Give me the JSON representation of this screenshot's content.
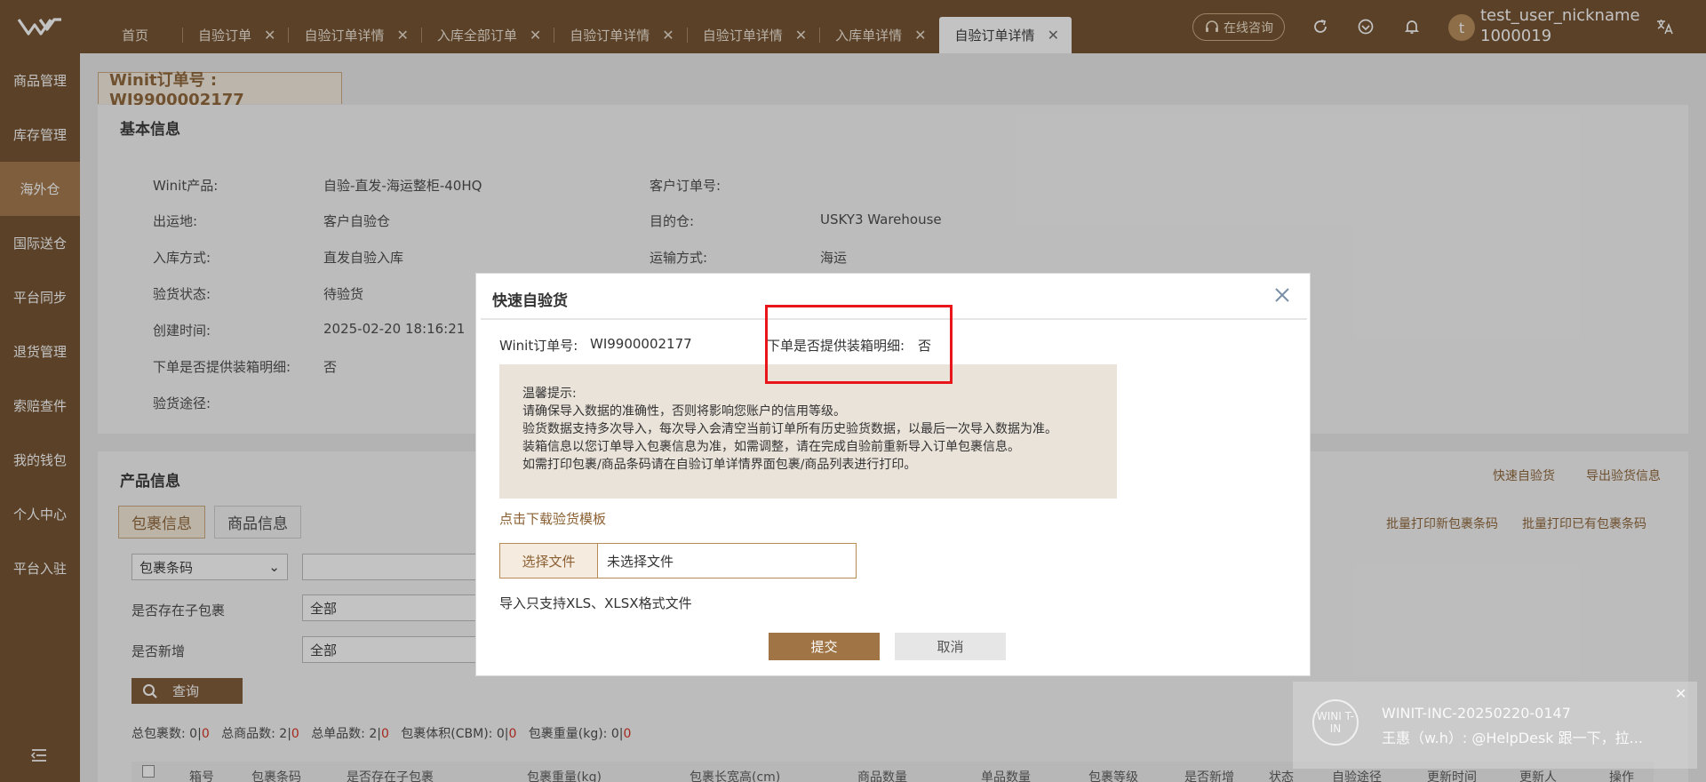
{
  "header": {
    "tabs": [
      {
        "label": "首页"
      },
      {
        "label": "自验订单"
      },
      {
        "label": "自验订单详情"
      },
      {
        "label": "入库全部订单"
      },
      {
        "label": "自验订单详情"
      },
      {
        "label": "自验订单详情"
      },
      {
        "label": "入库单详情"
      },
      {
        "label": "自验订单详情"
      }
    ],
    "active_tab_index": 7,
    "consult_label": "在线咨询",
    "user_initial": "t",
    "user_name": "test_user_nickname",
    "user_id": "1000019"
  },
  "sidebar": {
    "items": [
      {
        "label": "商品管理"
      },
      {
        "label": "库存管理"
      },
      {
        "label": "海外仓"
      },
      {
        "label": "国际送仓"
      },
      {
        "label": "平台同步"
      },
      {
        "label": "退货管理"
      },
      {
        "label": "索赔查件"
      },
      {
        "label": "我的钱包"
      },
      {
        "label": "个人中心"
      },
      {
        "label": "平台入驻"
      }
    ],
    "active_index": 2
  },
  "page": {
    "order_tab": "Winit订单号 : WI9900002177",
    "basic_title": "基本信息",
    "basic": {
      "product_label": "Winit产品:",
      "product_value": "自验-直发-海运整柜-40HQ",
      "customer_no_label": "客户订单号:",
      "origin_label": "出运地:",
      "origin_value": "客户自验仓",
      "dest_label": "目的仓:",
      "dest_value": "USKY3 Warehouse",
      "inbound_label": "入库方式:",
      "inbound_value": "直发自验入库",
      "transport_label": "运输方式:",
      "transport_value": "海运",
      "status_label": "验货状态:",
      "status_value": "待验货",
      "created_label": "创建时间:",
      "created_value": "2025-02-20 18:16:21",
      "packing_label": "下单是否提供装箱明细:",
      "packing_value": "否",
      "route_label": "验货途径:"
    },
    "product_title": "产品信息",
    "quick_inspect_link": "快速自验货",
    "export_link": "导出验货信息",
    "inner_tabs": [
      {
        "label": "包裹信息"
      },
      {
        "label": "商品信息"
      }
    ],
    "batch_print_new": "批量打印新包裹条码",
    "batch_print_existing": "批量打印已有包裹条码",
    "filter_select": "包裹条码",
    "has_child_label": "是否存在子包裹",
    "has_child_value": "全部",
    "is_new_label": "是否新增",
    "is_new_value": "全部",
    "query_label": "查询",
    "stats": {
      "pkg_label": "总包裹数:",
      "pkg_a": "0",
      "pkg_b": "0",
      "goods_label": "总商品数:",
      "goods_a": "2",
      "goods_b": "0",
      "single_label": "总单品数:",
      "single_a": "2",
      "single_b": "0",
      "vol_label": "包裹体积(CBM):",
      "vol_a": "0",
      "vol_b": "0",
      "weight_label": "包裹重量(kg):",
      "weight_a": "0",
      "weight_b": "0"
    },
    "table_headers": [
      "箱号",
      "包裹条码",
      "是否存在子包裹",
      "包裹重量(kg)",
      "包裹长宽高(cm)",
      "商品数量",
      "单品数量",
      "包裹等级",
      "是否新增",
      "状态",
      "自验途径",
      "更新时间",
      "更新人",
      "操作"
    ]
  },
  "modal": {
    "title": "快速自验货",
    "order_label": "Winit订单号:",
    "order_value": "WI9900002177",
    "packing_label": "下单是否提供装箱明细:",
    "packing_value": "否",
    "tips": [
      "温馨提示:",
      "请确保导入数据的准确性，否则将影响您账户的信用等级。",
      "验货数据支持多次导入，每次导入会清空当前订单所有历史验货数据，以最后一次导入数据为准。",
      "装箱信息以您订单导入包裹信息为准，如需调整，请在完成自验前重新导入订单包裹信息。",
      "如需打印包裹/商品条码请在自验订单详情界面包裹/商品列表进行打印。"
    ],
    "template_link": "点击下载验货模板",
    "choose_file": "选择文件",
    "no_file": "未选择文件",
    "format_note": "导入只支持XLS、XLSX格式文件",
    "submit": "提交",
    "cancel": "取消"
  },
  "toast": {
    "avatar_text": "WINI T-IN",
    "title": "WINIT-INC-20250220-0147",
    "message": "王惠（w.h）: @HelpDesk 跟一下，拉..."
  },
  "colors": {
    "brand": "#6e4b28",
    "accent": "#a07445",
    "highlight": "#e8161b"
  }
}
